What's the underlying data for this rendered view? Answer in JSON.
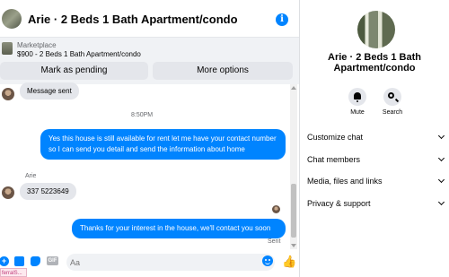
{
  "header": {
    "title": "Arie · 2 Beds 1 Bath Apartment/condo"
  },
  "listing": {
    "marketplace_label": "Marketplace",
    "price_title": "$900 - 2 Beds 1 Bath Apartment/condo",
    "mark_pending_label": "Mark as pending",
    "more_options_label": "More options"
  },
  "messages": {
    "first_incoming": "Message sent",
    "timestamp": "8:50PM",
    "outgoing_1": "Yes this house is still available for rent let me have your contact number so I can send you detail and send the information about home",
    "sender_name": "Arie",
    "incoming_2": "337 5223649",
    "outgoing_2": "Thanks for your interest in the house, we'll contact you soon",
    "status": "Sent"
  },
  "composer": {
    "placeholder": "Aa",
    "gif_label": "GIF",
    "plus_glyph": "+",
    "like_glyph": "👍"
  },
  "taskbar": {
    "tag_text": "ferralS..."
  },
  "info_pane": {
    "name": "Arie · 2 Beds 1 Bath Apartment/condo",
    "mute_label": "Mute",
    "search_label": "Search",
    "sections": [
      "Customize chat",
      "Chat members",
      "Media, files and links",
      "Privacy & support"
    ]
  },
  "colors": {
    "accent": "#0084ff",
    "incoming_bubble": "#e4e6eb",
    "secondary_text": "#65676b"
  }
}
